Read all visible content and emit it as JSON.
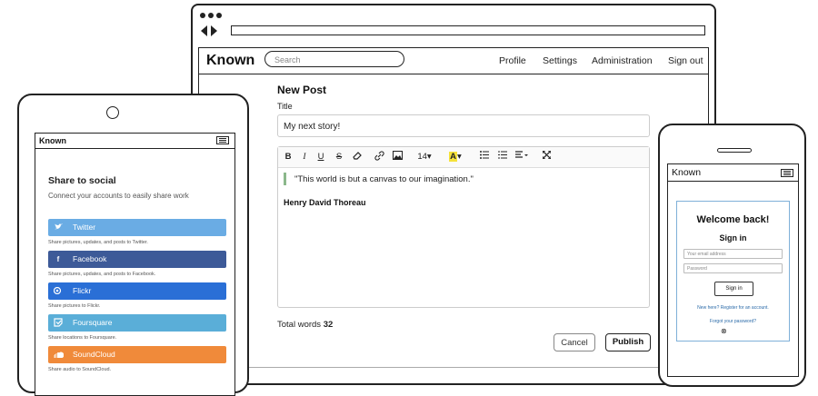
{
  "desktop": {
    "brand": "Known",
    "search_placeholder": "Search",
    "nav": [
      "Profile",
      "Settings",
      "Administration",
      "Sign out"
    ],
    "new_post": {
      "heading": "New Post",
      "title_label": "Title",
      "title_value": "My next story!",
      "toolbar": {
        "bold": "B",
        "italic": "I",
        "underline": "U",
        "strike": "S",
        "eraser_icon": "eraser-icon",
        "link_icon": "link-icon",
        "image_icon": "image-icon",
        "font_size": "14",
        "highlight": "A",
        "bullet_icon": "bulleted-list-icon",
        "number_icon": "numbered-list-icon",
        "align_icon": "align-icon",
        "fullscreen_icon": "fullscreen-icon"
      },
      "quote": "\"This world is but a canvas to our imagination.\"",
      "author": "Henry David Thoreau",
      "word_count_label": "Total words",
      "word_count": "32",
      "cancel": "Cancel",
      "publish": "Publish"
    }
  },
  "tablet": {
    "brand": "Known",
    "heading": "Share to social",
    "subheading": "Connect your accounts to easily share work",
    "services": [
      {
        "name": "Twitter",
        "desc": "Share pictures, updates, and posts to Twitter.",
        "color": "#6aace4",
        "icon": "twitter-icon",
        "glyph": "🐦"
      },
      {
        "name": "Facebook",
        "desc": "Share pictures, updates, and posts to Facebook.",
        "color": "#3d5a98",
        "icon": "facebook-icon",
        "glyph": "f"
      },
      {
        "name": "Flickr",
        "desc": "Share pictures to Flickr.",
        "color": "#2a6fd6",
        "icon": "flickr-icon",
        "glyph": "●●"
      },
      {
        "name": "Foursquare",
        "desc": "Share locations to Foursquare.",
        "color": "#5aaed8",
        "icon": "foursquare-icon",
        "glyph": "✓"
      },
      {
        "name": "SoundCloud",
        "desc": "Share audio to SoundCloud.",
        "color": "#f08a3a",
        "icon": "soundcloud-icon",
        "glyph": "☁"
      }
    ]
  },
  "phone": {
    "brand": "Known",
    "welcome": "Welcome back!",
    "signin_heading": "Sign in",
    "email_placeholder": "Your email address",
    "password_placeholder": "Password",
    "signin_button": "Sign in",
    "register_link": "New here? Register for an account.",
    "forgot_link": "Forgot your password?"
  }
}
